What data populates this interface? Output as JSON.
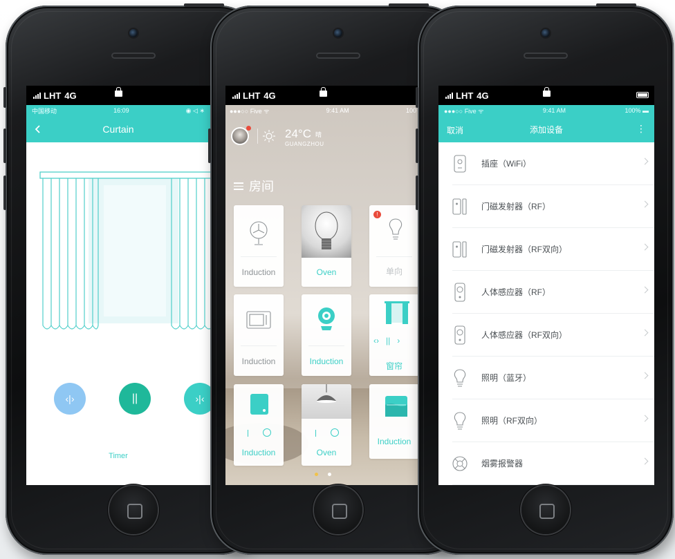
{
  "colors": {
    "accent": "#3bcfc6",
    "blue_button": "#8fc7f3",
    "teal_button": "#1fb89a",
    "carrier_bar": "#000000"
  },
  "phones": {
    "left": {
      "carrier": {
        "signal_label": "LHT",
        "network": "4G"
      },
      "status": {
        "carrier": "中国移动",
        "time": "16:09"
      },
      "header": {
        "title": "Curtain",
        "back_icon": "chevron-left-icon"
      },
      "controls": {
        "open_icon": "expand-icon",
        "pause_icon": "pause-icon",
        "close_icon": "collapse-icon",
        "timer_label": "Timer"
      }
    },
    "middle": {
      "carrier": {
        "signal_label": "LHT",
        "network": "4G"
      },
      "status": {
        "carrier": "Five",
        "time": "9:41 AM",
        "battery": "100"
      },
      "weather": {
        "temperature": "24°C",
        "condition": "晴",
        "city": "GUANGZHOU",
        "icon": "sun-icon"
      },
      "section_title": "房间",
      "tiles": [
        {
          "label": "Induction",
          "icon": "fan-icon",
          "accent": false
        },
        {
          "label": "Oven",
          "icon": "bulb-photo",
          "accent": true
        },
        {
          "label": "单向",
          "icon": "light-bulb-icon",
          "accent": false,
          "alert": true
        },
        {
          "label": "Induction",
          "icon": "microwave-icon",
          "accent": false
        },
        {
          "label": "Induction",
          "icon": "camera-icon",
          "accent": true
        },
        {
          "label": "窗帘",
          "icon": "curtain-icon",
          "accent": true
        },
        {
          "label": "Induction",
          "icon": "socket-icon",
          "accent": true
        },
        {
          "label": "Oven",
          "icon": "lamp-photo",
          "accent": true
        },
        {
          "label": "Induction",
          "icon": "aquarium-icon",
          "accent": true
        }
      ]
    },
    "right": {
      "carrier": {
        "signal_label": "LHT",
        "network": "4G"
      },
      "status": {
        "carrier": "Five",
        "time": "9:41 AM",
        "battery": "100%"
      },
      "header": {
        "cancel_label": "取消",
        "title": "添加设备",
        "more_icon": "more-vertical-icon"
      },
      "devices": [
        {
          "label": "插座（WiFi）",
          "icon": "plug-icon"
        },
        {
          "label": "门磁发射器（RF）",
          "icon": "door-sensor-icon"
        },
        {
          "label": "门磁发射器（RF双向）",
          "icon": "door-sensor-icon"
        },
        {
          "label": "人体感应器（RF）",
          "icon": "motion-sensor-icon"
        },
        {
          "label": "人体感应器（RF双向）",
          "icon": "motion-sensor-icon"
        },
        {
          "label": "照明（蓝牙）",
          "icon": "bulb-icon"
        },
        {
          "label": "照明（RF双向）",
          "icon": "bulb-icon"
        },
        {
          "label": "烟雾报警器",
          "icon": "smoke-alarm-icon"
        }
      ]
    }
  }
}
